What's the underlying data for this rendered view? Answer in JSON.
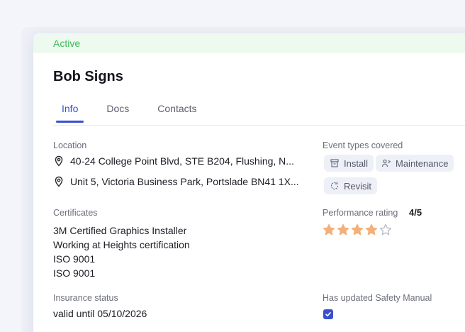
{
  "status": "Active",
  "title": "Bob Signs",
  "tabs": [
    {
      "label": "Info",
      "active": true
    },
    {
      "label": "Docs",
      "active": false
    },
    {
      "label": "Contacts",
      "active": false
    }
  ],
  "location": {
    "label": "Location",
    "addresses": [
      "40-24 College Point Blvd, STE B204, Flushing, N...",
      "Unit 5, Victoria Business Park, Portslade BN41 1X..."
    ]
  },
  "event_types": {
    "label": "Event types covered",
    "chips": [
      {
        "label": "Install",
        "icon": "install-icon"
      },
      {
        "label": "Maintenance",
        "icon": "maintenance-icon"
      },
      {
        "label": "Revisit",
        "icon": "revisit-icon"
      }
    ]
  },
  "certificates": {
    "label": "Certificates",
    "items": [
      "3M Certified Graphics Installer",
      "Working at Heights certification",
      "ISO 9001",
      "ISO 9001"
    ]
  },
  "performance": {
    "label": "Performance rating",
    "value_text": "4/5",
    "rating": 4,
    "max": 5,
    "star_color": "#f3b07a"
  },
  "insurance": {
    "label": "Insurance status",
    "value": "valid until 05/10/2026"
  },
  "safety_manual": {
    "label": "Has updated Safety Manual",
    "checked": true
  },
  "colors": {
    "accent": "#3a4fcf",
    "status_green": "#3fba5b",
    "status_bg": "#eefaef"
  }
}
